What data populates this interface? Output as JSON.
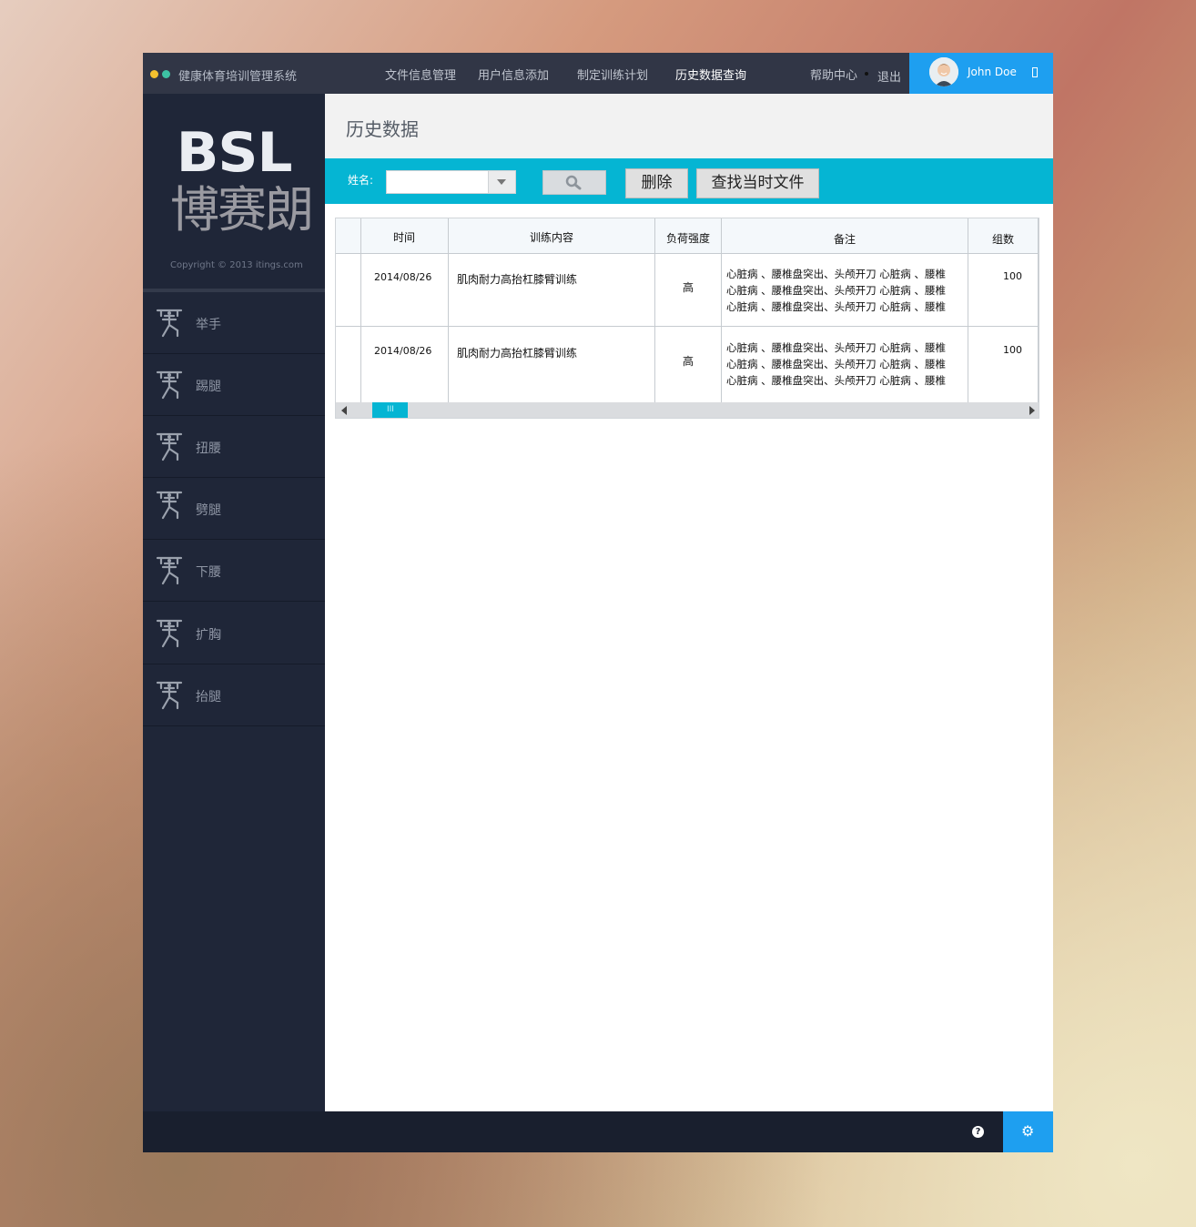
{
  "app": {
    "title": "健康体育培训管理系统",
    "nav": [
      "文件信息管理",
      "用户信息添加",
      "制定训练计划",
      "历史数据查询"
    ],
    "help": "帮助中心",
    "logout": "退出",
    "user_name": "John Doe"
  },
  "sidebar": {
    "logo_en": "BSL",
    "logo_cn": "博赛朗",
    "copyright": "Copyright © 2013    itings.com",
    "items": [
      {
        "label": "举手",
        "icon": "lifter-icon"
      },
      {
        "label": "踢腿",
        "icon": "lifter-icon"
      },
      {
        "label": "扭腰",
        "icon": "lifter-icon"
      },
      {
        "label": "劈腿",
        "icon": "lifter-icon"
      },
      {
        "label": "下腰",
        "icon": "lifter-icon"
      },
      {
        "label": "扩胸",
        "icon": "lifter-icon"
      },
      {
        "label": "抬腿",
        "icon": "lifter-icon"
      }
    ]
  },
  "page": {
    "title": "历史数据",
    "name_label": "姓名:",
    "name_value": "",
    "delete_label": "删除",
    "find_label": "查找当时文件"
  },
  "table": {
    "headers": [
      "",
      "时间",
      "训练内容",
      "负荷强度",
      "备注",
      "组数"
    ],
    "rows": [
      {
        "time": "2014/08/26",
        "content": "肌肉耐力高抬杠膝臂训练",
        "intensity": "高",
        "remarks": [
          "心脏病 、腰椎盘突出、头颅开刀 心脏病 、腰椎",
          "心脏病 、腰椎盘突出、头颅开刀 心脏病 、腰椎",
          "心脏病 、腰椎盘突出、头颅开刀 心脏病 、腰椎"
        ],
        "sets": "100"
      },
      {
        "time": "2014/08/26",
        "content": "肌肉耐力高抬杠膝臂训练",
        "intensity": "高",
        "remarks": [
          "心脏病 、腰椎盘突出、头颅开刀 心脏病 、腰椎",
          "心脏病 、腰椎盘突出、头颅开刀 心脏病 、腰椎",
          "心脏病 、腰椎盘突出、头颅开刀 心脏病 、腰椎"
        ],
        "sets": "100"
      }
    ],
    "scroll_thumb": "III"
  },
  "footer": {
    "help_glyph": "?",
    "settings_glyph": "⚙"
  },
  "colors": {
    "accent": "#05b5d3",
    "brand_blue": "#1e9ff0",
    "sidebar": "#1f2638",
    "topbar": "#313646"
  }
}
